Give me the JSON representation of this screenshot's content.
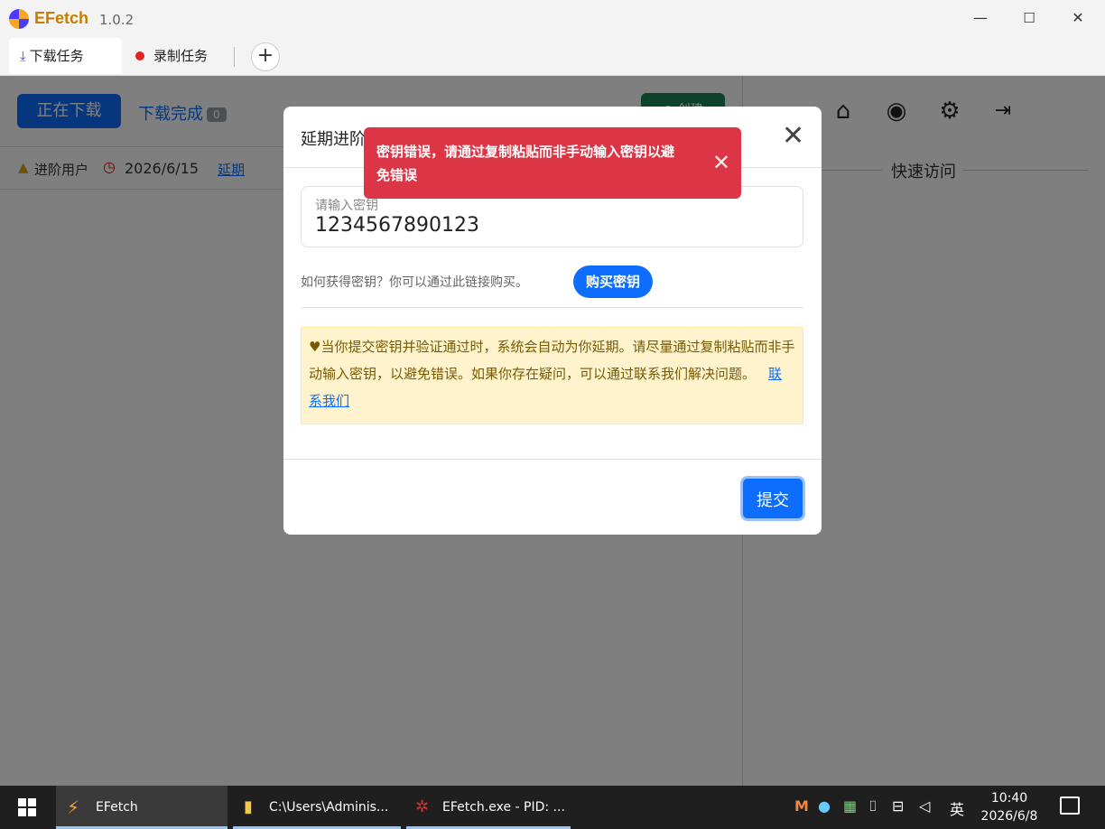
{
  "titlebar": {
    "app_name": "EFetch",
    "version": "1.0.2",
    "minimize": "—",
    "maximize": "☐",
    "close": "✕"
  },
  "tabs": [
    {
      "label": "下载任务",
      "icon": "download-icon"
    },
    {
      "label": "录制任务",
      "icon": "record-dot-icon"
    }
  ],
  "add_tab_label": "+",
  "main": {
    "downloading_label": "正在下载",
    "done_label": "下载完成",
    "done_count": "0",
    "create_label": "创建"
  },
  "userbar": {
    "level": "进阶用户",
    "date": "2026/6/15",
    "extend_label": "延期"
  },
  "side": {
    "quick_access": "快速访问",
    "icons": [
      "home-icon",
      "user-circle-icon",
      "gear-icon",
      "logout-icon"
    ]
  },
  "modal": {
    "title": "延期进阶",
    "close": "✕",
    "key_placeholder": "请输入密钥",
    "key_value": "1234567890123",
    "how_text": "如何获得密钥？你可以通过此链接购买。",
    "buy_label": "购买密钥",
    "notice_text": "当你提交密钥并验证通过时，系统会自动为你延期。请尽量通过复制粘贴而非手动输入密钥，以避免错误。如果你存在疑问，可以通过联系我们解决问题。",
    "contact_label": "联系我们",
    "submit_label": "提交"
  },
  "toast": {
    "message": "密钥错误，请通过复制粘贴而非手动输入密钥以避免错误",
    "close": "✕"
  },
  "taskbar": {
    "apps": [
      {
        "label": "EFetch",
        "icon": "efetch-icon"
      },
      {
        "label": "C:\\Users\\Adminis...",
        "icon": "folder-icon"
      },
      {
        "label": "EFetch.exe - PID: ...",
        "icon": "debugger-icon"
      }
    ],
    "tray_lang": "英",
    "time": "10:40",
    "date": "2026/6/8"
  },
  "colors": {
    "primary": "#0d6efd",
    "danger": "#dc3545",
    "success": "#198754",
    "warning_bg": "#fff3cd"
  }
}
